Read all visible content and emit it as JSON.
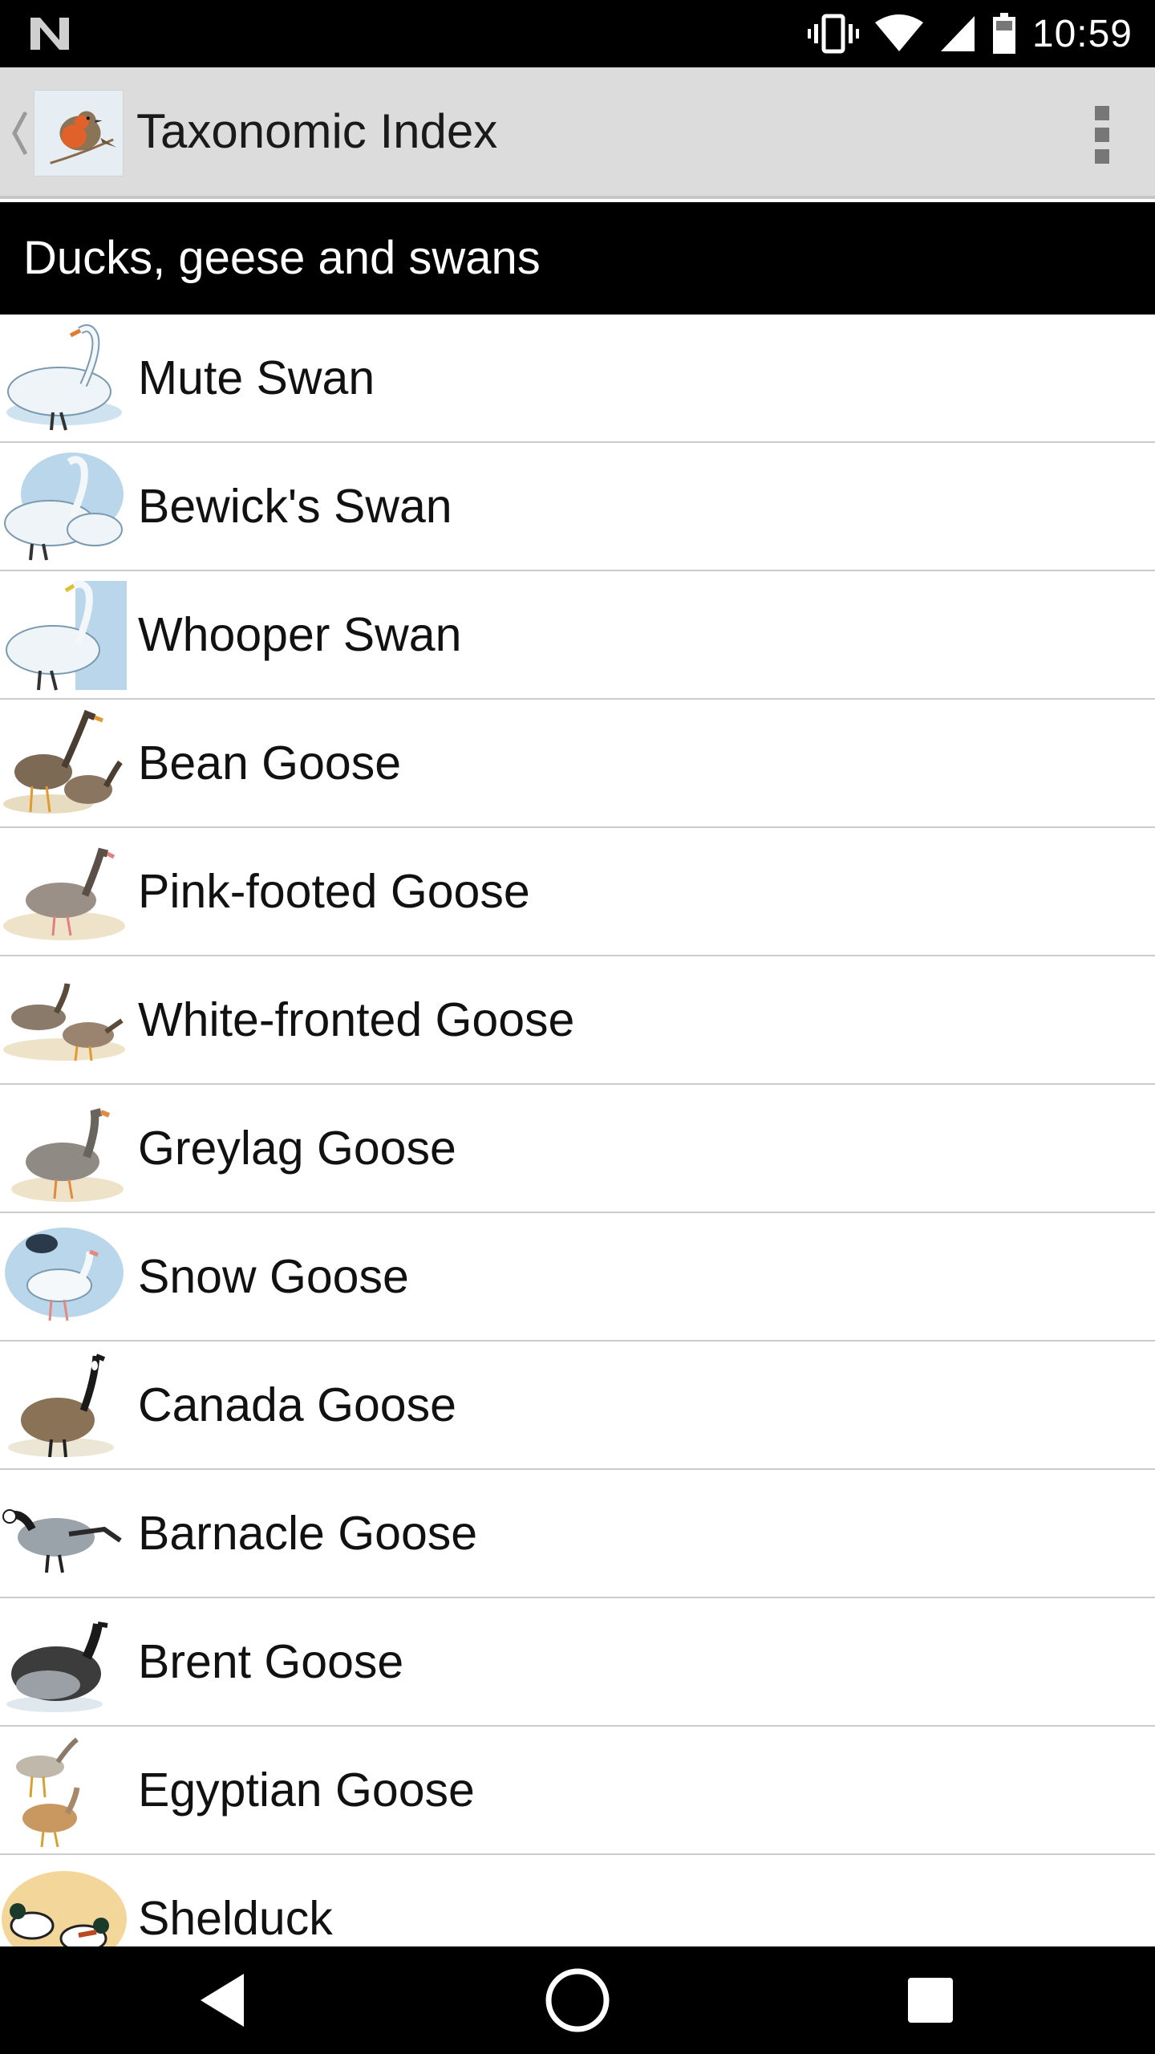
{
  "status_bar": {
    "time": "10:59",
    "icons": [
      "notification-n-icon",
      "vibrate-icon",
      "wifi-icon",
      "cell-signal-icon",
      "battery-icon"
    ]
  },
  "action_bar": {
    "title": "Taxonomic Index",
    "icons": [
      "up-caret-icon",
      "robin-logo-icon",
      "overflow-menu-icon"
    ],
    "background_color": "#dcdcdc"
  },
  "section": {
    "title": "Ducks, geese and swans",
    "background_color": "#000000"
  },
  "birds": [
    {
      "name": "Mute Swan",
      "icon": "swan-thumbnail-icon"
    },
    {
      "name": "Bewick's Swan",
      "icon": "swan-thumbnail-icon"
    },
    {
      "name": "Whooper Swan",
      "icon": "swan-thumbnail-icon"
    },
    {
      "name": "Bean Goose",
      "icon": "goose-thumbnail-icon"
    },
    {
      "name": "Pink-footed Goose",
      "icon": "goose-thumbnail-icon"
    },
    {
      "name": "White-fronted Goose",
      "icon": "goose-thumbnail-icon"
    },
    {
      "name": "Greylag Goose",
      "icon": "goose-thumbnail-icon"
    },
    {
      "name": "Snow Goose",
      "icon": "goose-thumbnail-icon"
    },
    {
      "name": "Canada Goose",
      "icon": "goose-thumbnail-icon"
    },
    {
      "name": "Barnacle Goose",
      "icon": "goose-thumbnail-icon"
    },
    {
      "name": "Brent Goose",
      "icon": "goose-thumbnail-icon"
    },
    {
      "name": "Egyptian Goose",
      "icon": "goose-thumbnail-icon"
    },
    {
      "name": "Shelduck",
      "icon": "duck-thumbnail-icon"
    }
  ],
  "nav_bar": {
    "icons": [
      "back-triangle-icon",
      "home-circle-icon",
      "recents-square-icon"
    ]
  }
}
